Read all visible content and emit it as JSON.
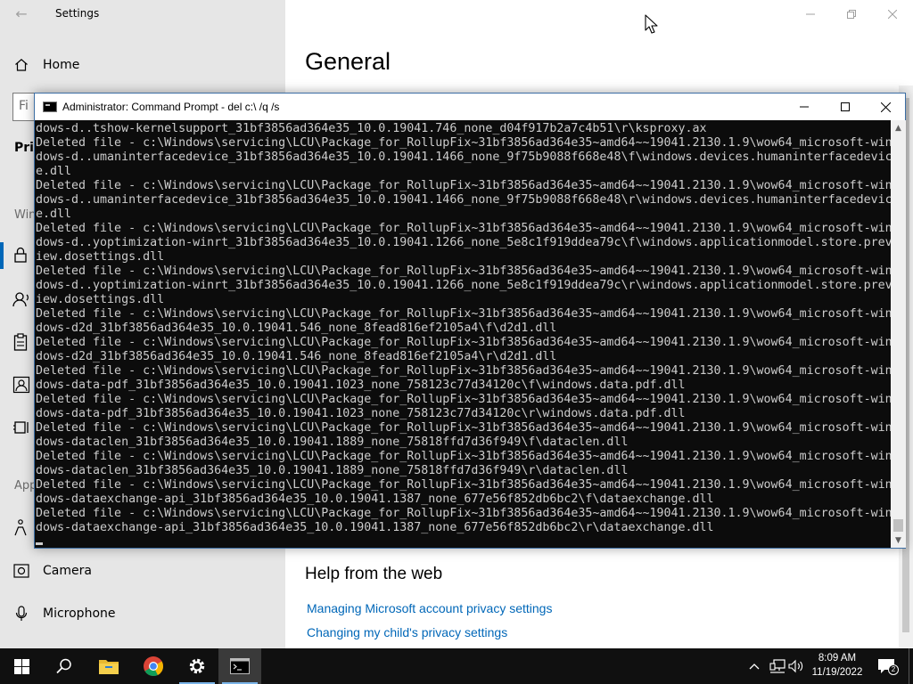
{
  "settings": {
    "title": "Settings",
    "search_placeholder": "Fi",
    "home_label": "Home",
    "privacy_partial": "Priv",
    "windows_perms_partial": "Win",
    "app_perms_partial": "App",
    "page_title": "General",
    "camera_label": "Camera",
    "microphone_label": "Microphone",
    "help": {
      "header": "Help from the web",
      "links": [
        "Managing Microsoft account privacy settings",
        "Changing my child's privacy settings"
      ]
    }
  },
  "cmd": {
    "title": "Administrator: Command Prompt - del  c:\\ /q /s",
    "lines": [
      "dows-d..tshow-kernelsupport_31bf3856ad364e35_10.0.19041.746_none_d04f917b2a7c4b51\\r\\ksproxy.ax",
      "Deleted file - c:\\Windows\\servicing\\LCU\\Package_for_RollupFix~31bf3856ad364e35~amd64~~19041.2130.1.9\\wow64_microsoft-win",
      "dows-d..umaninterfacedevice_31bf3856ad364e35_10.0.19041.1466_none_9f75b9088f668e48\\f\\windows.devices.humaninterfacedevic",
      "e.dll",
      "Deleted file - c:\\Windows\\servicing\\LCU\\Package_for_RollupFix~31bf3856ad364e35~amd64~~19041.2130.1.9\\wow64_microsoft-win",
      "dows-d..umaninterfacedevice_31bf3856ad364e35_10.0.19041.1466_none_9f75b9088f668e48\\r\\windows.devices.humaninterfacedevic",
      "e.dll",
      "Deleted file - c:\\Windows\\servicing\\LCU\\Package_for_RollupFix~31bf3856ad364e35~amd64~~19041.2130.1.9\\wow64_microsoft-win",
      "dows-d..yoptimization-winrt_31bf3856ad364e35_10.0.19041.1266_none_5e8c1f919ddea79c\\f\\windows.applicationmodel.store.prev",
      "iew.dosettings.dll",
      "Deleted file - c:\\Windows\\servicing\\LCU\\Package_for_RollupFix~31bf3856ad364e35~amd64~~19041.2130.1.9\\wow64_microsoft-win",
      "dows-d..yoptimization-winrt_31bf3856ad364e35_10.0.19041.1266_none_5e8c1f919ddea79c\\r\\windows.applicationmodel.store.prev",
      "iew.dosettings.dll",
      "Deleted file - c:\\Windows\\servicing\\LCU\\Package_for_RollupFix~31bf3856ad364e35~amd64~~19041.2130.1.9\\wow64_microsoft-win",
      "dows-d2d_31bf3856ad364e35_10.0.19041.546_none_8fead816ef2105a4\\f\\d2d1.dll",
      "Deleted file - c:\\Windows\\servicing\\LCU\\Package_for_RollupFix~31bf3856ad364e35~amd64~~19041.2130.1.9\\wow64_microsoft-win",
      "dows-d2d_31bf3856ad364e35_10.0.19041.546_none_8fead816ef2105a4\\r\\d2d1.dll",
      "Deleted file - c:\\Windows\\servicing\\LCU\\Package_for_RollupFix~31bf3856ad364e35~amd64~~19041.2130.1.9\\wow64_microsoft-win",
      "dows-data-pdf_31bf3856ad364e35_10.0.19041.1023_none_758123c77d34120c\\f\\windows.data.pdf.dll",
      "Deleted file - c:\\Windows\\servicing\\LCU\\Package_for_RollupFix~31bf3856ad364e35~amd64~~19041.2130.1.9\\wow64_microsoft-win",
      "dows-data-pdf_31bf3856ad364e35_10.0.19041.1023_none_758123c77d34120c\\r\\windows.data.pdf.dll",
      "Deleted file - c:\\Windows\\servicing\\LCU\\Package_for_RollupFix~31bf3856ad364e35~amd64~~19041.2130.1.9\\wow64_microsoft-win",
      "dows-dataclen_31bf3856ad364e35_10.0.19041.1889_none_75818ffd7d36f949\\f\\dataclen.dll",
      "Deleted file - c:\\Windows\\servicing\\LCU\\Package_for_RollupFix~31bf3856ad364e35~amd64~~19041.2130.1.9\\wow64_microsoft-win",
      "dows-dataclen_31bf3856ad364e35_10.0.19041.1889_none_75818ffd7d36f949\\r\\dataclen.dll",
      "Deleted file - c:\\Windows\\servicing\\LCU\\Package_for_RollupFix~31bf3856ad364e35~amd64~~19041.2130.1.9\\wow64_microsoft-win",
      "dows-dataexchange-api_31bf3856ad364e35_10.0.19041.1387_none_677e56f852db6bc2\\f\\dataexchange.dll",
      "Deleted file - c:\\Windows\\servicing\\LCU\\Package_for_RollupFix~31bf3856ad364e35~amd64~~19041.2130.1.9\\wow64_microsoft-win",
      "dows-dataexchange-api_31bf3856ad364e35_10.0.19041.1387_none_677e56f852db6bc2\\r\\dataexchange.dll"
    ]
  },
  "taskbar": {
    "apps": [
      "start-icon",
      "search-icon",
      "file-explorer-icon",
      "chrome-icon",
      "settings-gear-icon",
      "command-prompt-icon"
    ],
    "time": "8:09 AM",
    "date": "11/19/2022",
    "notification_count": "2"
  },
  "colors": {
    "link": "#0067b8",
    "console_bg": "#0c0c0c",
    "console_text": "#cccccc",
    "taskbar_bg": "#101010"
  }
}
